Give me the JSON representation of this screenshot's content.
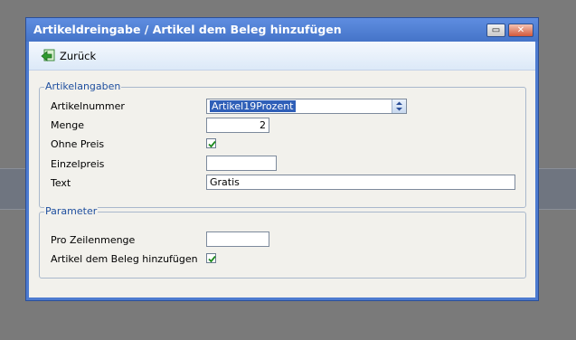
{
  "window": {
    "title": "Artikeldreingabe / Artikel dem Beleg hinzufügen",
    "restore_icon": "restore-icon",
    "close_icon": "close-icon"
  },
  "toolbar": {
    "back_label": "Zurück",
    "back_icon": "back-arrow-icon"
  },
  "artikelangaben": {
    "legend": "Artikelangaben",
    "artikelnummer_label": "Artikelnummer",
    "artikelnummer_value": "Artikel19Prozent",
    "menge_label": "Menge",
    "menge_value": "2",
    "ohne_preis_label": "Ohne Preis",
    "ohne_preis_checked": true,
    "einzelpreis_label": "Einzelpreis",
    "einzelpreis_value": "",
    "text_label": "Text",
    "text_value": "Gratis"
  },
  "parameter": {
    "legend": "Parameter",
    "pro_zeilenmenge_label": "Pro Zeilenmenge",
    "pro_zeilenmenge_value": "",
    "artikel_beleg_label": "Artikel dem Beleg hinzufügen",
    "artikel_beleg_checked": true
  },
  "colors": {
    "titlebar": "#4d7bd0",
    "client_bg": "#f2f1ec",
    "legend_text": "#1f4f9f",
    "checkmark": "#1d8a1d"
  }
}
